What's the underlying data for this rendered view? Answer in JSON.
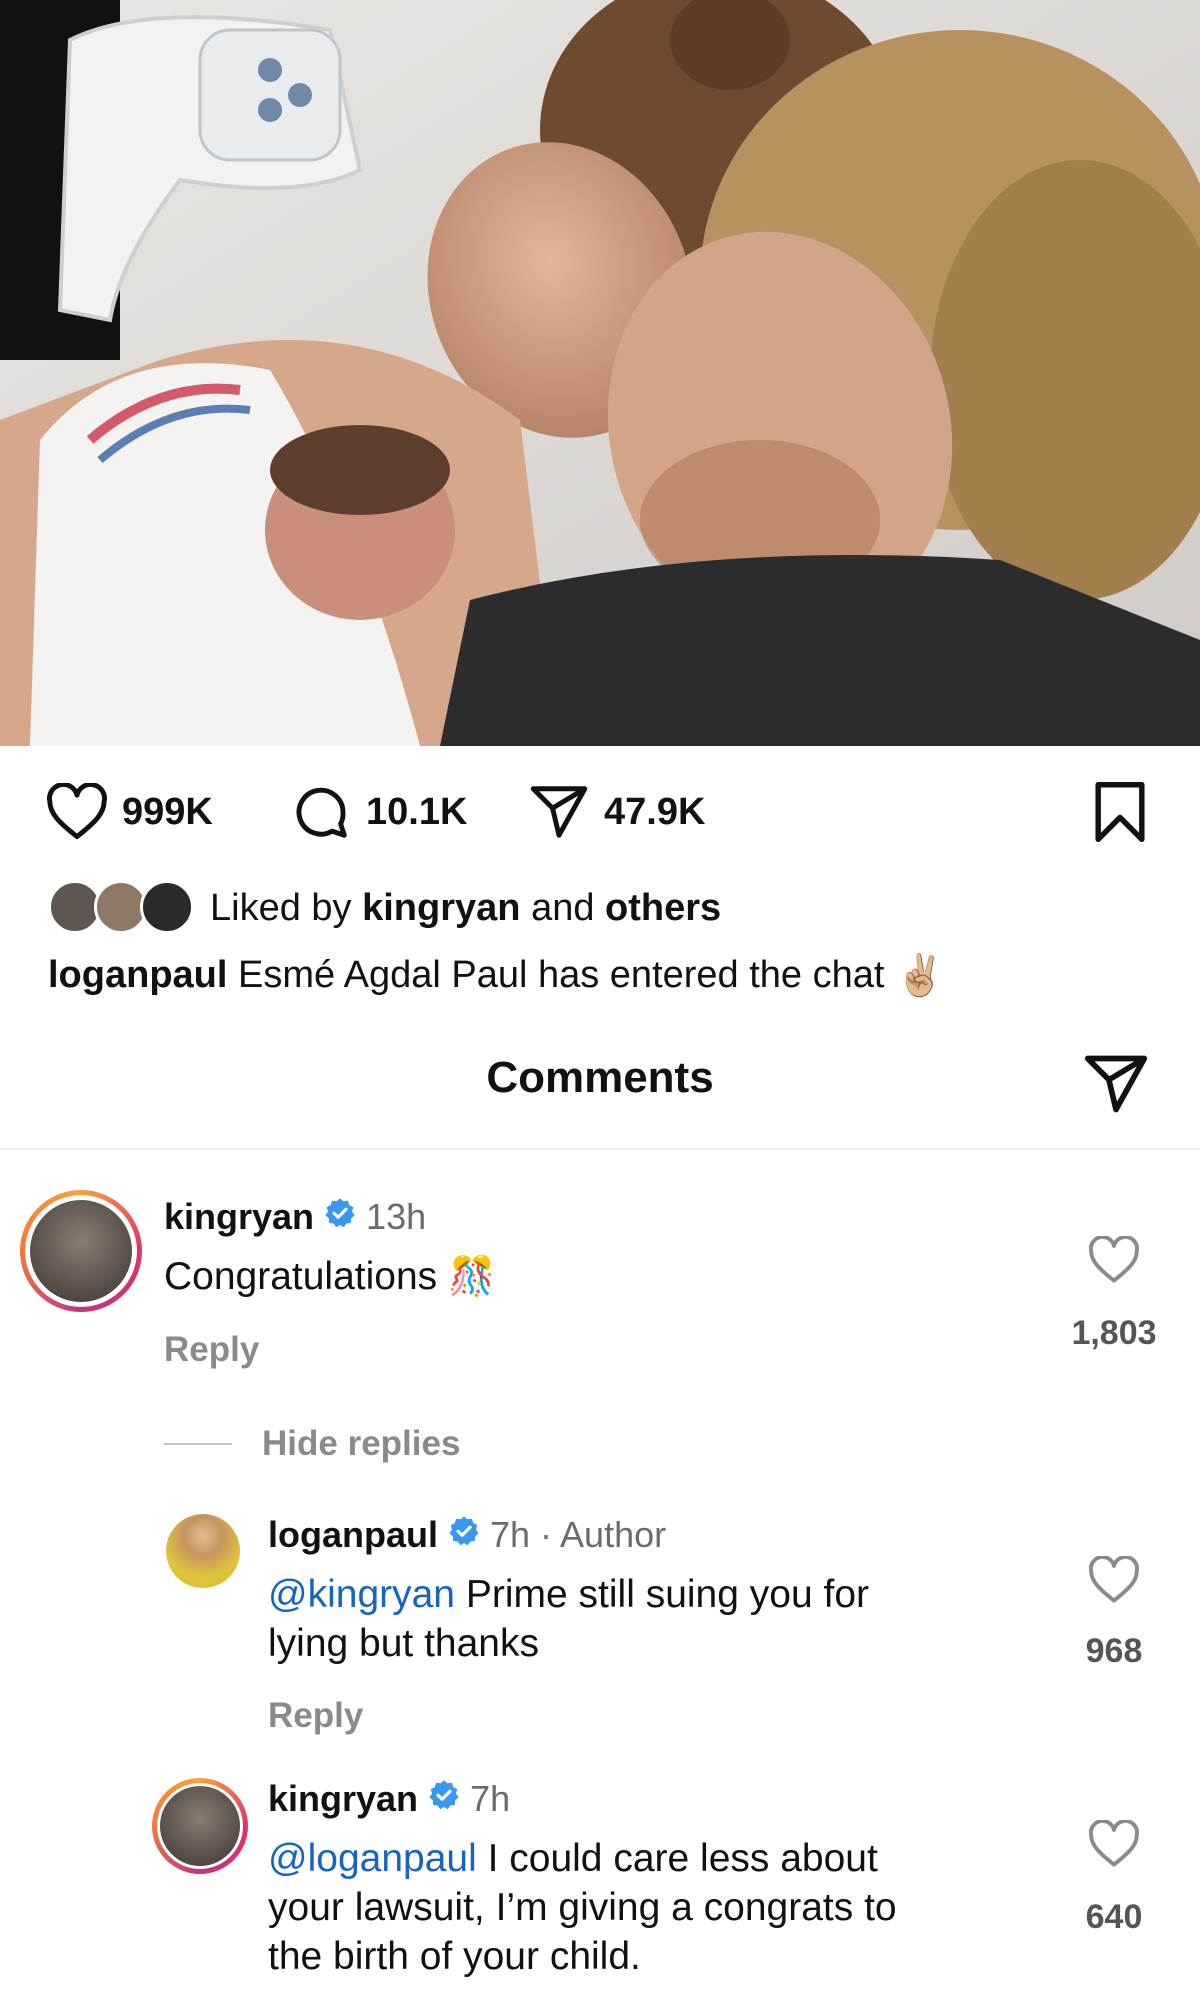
{
  "post": {
    "likes": "999K",
    "comments": "10.1K",
    "shares": "47.9K",
    "liked_by_prefix": "Liked by",
    "liked_by_user": "kingryan",
    "liked_by_and": "and",
    "liked_by_others": "others",
    "caption_user": "loganpaul",
    "caption_text": "Esmé Agdal Paul has entered the chat",
    "caption_emoji": "✌🏼"
  },
  "sheet": {
    "title": "Comments"
  },
  "comments": [
    {
      "user": "kingryan",
      "time": "13h",
      "text": "Congratulations",
      "emoji": "🎊",
      "reply_label": "Reply",
      "likes": "1,803"
    },
    {
      "user": "loganpaul",
      "time": "7h · Author",
      "mention": "@kingryan",
      "text_line1": " Prime still suing you for",
      "text_line2": "lying but thanks",
      "reply_label": "Reply",
      "likes": "968"
    },
    {
      "user": "kingryan",
      "time": "7h",
      "mention": "@loganpaul",
      "text_line1": " I could care less about",
      "text_line2": "your lawsuit, I’m giving a congrats to",
      "text_line3": "the birth of your child.",
      "likes": "640"
    }
  ],
  "hide_replies": "Hide replies",
  "colors": {
    "mention": "#1565c0",
    "verified": "#3897f0",
    "muted": "#8a8a8a"
  },
  "icons": [
    "heart-icon",
    "comment-icon",
    "share-icon",
    "bookmark-icon",
    "verified-icon"
  ]
}
